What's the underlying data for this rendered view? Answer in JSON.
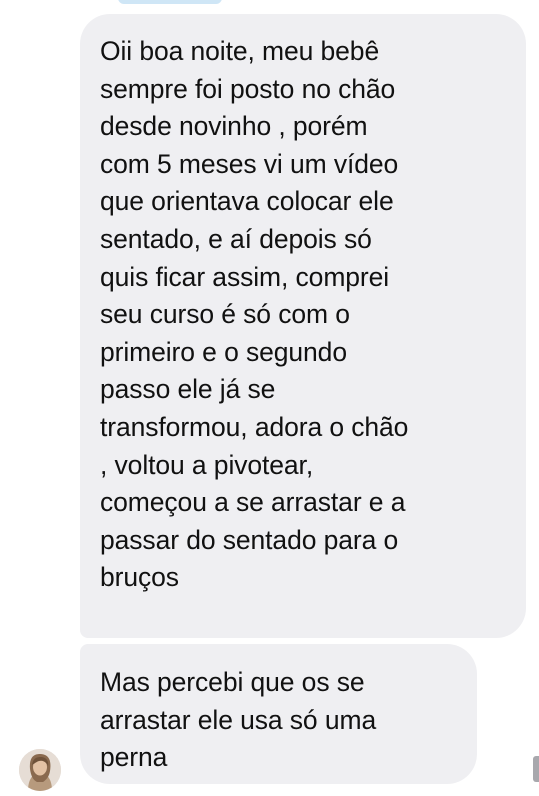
{
  "messages": [
    {
      "lines": [
        "Oii boa noite, meu bebê",
        "sempre foi posto no chão",
        "desde novinho , porém",
        "com 5 meses vi um vídeo",
        "que orientava colocar ele",
        "sentado, e aí depois só",
        "quis ficar assim, comprei",
        "seu curso é só com o",
        "primeiro e o segundo",
        "passo ele já se",
        "transformou, adora o chão",
        ", voltou a pivotear,",
        "começou a se arrastar e a",
        "passar do sentado para o",
        "bruços"
      ]
    },
    {
      "lines": [
        "Mas percebi que os se",
        "arrastar ele usa só uma",
        "perna"
      ]
    }
  ],
  "avatar": {
    "icon": "user-avatar-photo"
  },
  "colors": {
    "bubble_background": "#efeff2",
    "text": "#111111",
    "background": "#ffffff"
  }
}
